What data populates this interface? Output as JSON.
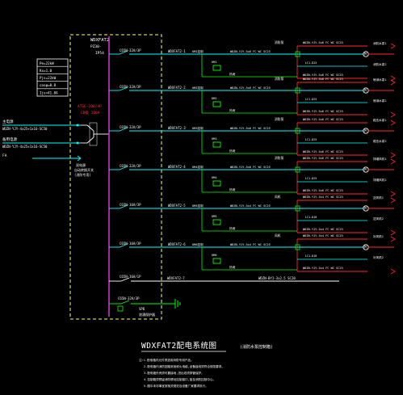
{
  "drawing": {
    "title": "WDXFAT2配电系统图",
    "subtitle": "(消防水泵控制箱)",
    "notes": [
      "注:1.配电箱内元件须选用消防专用产品。",
      "2.配电箱内消防回路采用耐火电缆,设备接线须符合规范要求。",
      "3.配电箱外壳须可靠接地,进出线须穿管保护。",
      "4.控制箱须预留消防联动控制接口,接至消防控制中心。",
      "5.图中未尽事宜按相关规范及设备厂家要求执行。"
    ]
  },
  "panel": {
    "name": "WDXFAT2",
    "sub": "PZ30-",
    "sub2": "IP54",
    "params": [
      "Pe=22kW",
      "Kx=1.0",
      "Pjs=22kW",
      "cosφ=0.8",
      "Ijs=41.8A"
    ],
    "ats": "ATSE-100/4P",
    "ats2": "CB级 100A",
    "ats_note1": "双电源",
    "ats_note2": "自动转换开关",
    "ats_note3": "(消防专用)",
    "feed1_label": "主电源",
    "feed1_cable": "WDZN-YJY-4x25+1x16-SC50",
    "feed2_label": "备用电源",
    "feed2_cable": "WDZN-YJY-4x25+1x16-SC50",
    "feed3_label": "FA",
    "feed3_text": "至消防控制中心"
  },
  "circuits": [
    {
      "breaker": "C65N-32A/3P",
      "id": "WDXFAT2-1",
      "cable": "WDZN-YJY-5x6 FC WC SC25",
      "tag": "KM1",
      "level": "消防泵",
      "sub_cable1": "WDZN-YJY-5x6 FC WC SC25",
      "sub_cable2": "WDZN-YJY-5x6 FC WC SC25",
      "contactor": "LC1-D25",
      "rel": "热继",
      "load1": "消防水泵1",
      "load2": "消防水泵2"
    },
    {
      "breaker": "C65N-32A/3P",
      "id": "WDXFAT2-2",
      "cable": "WDZN-YJY-5x6 FC WC SC25",
      "tag": "KM2",
      "level": "消防泵",
      "sub_cable1": "WDZN-YJY-5x6 FC WC SC25",
      "sub_cable2": "WDZN-YJY-5x6 FC WC SC25",
      "contactor": "LC1-D25",
      "rel": "热继",
      "load1": "喷淋水泵1",
      "load2": "喷淋水泵2"
    },
    {
      "breaker": "C65N-32A/3P",
      "id": "WDXFAT2-3",
      "cable": "WDZN-YJY-5x6 FC WC SC25",
      "tag": "KM3",
      "level": "消防泵",
      "sub_cable1": "WDZN-YJY-5x6 FC WC SC25",
      "sub_cable2": "WDZN-YJY-5x6 FC WC SC25",
      "contactor": "LC1-D25",
      "rel": "热继",
      "load1": "稳压水泵1",
      "load2": "稳压水泵2"
    },
    {
      "breaker": "C65N-32A/3P",
      "id": "WDXFAT2-4",
      "cable": "WDZN-YJY-5x6 FC WC SC25",
      "tag": "KM4",
      "level": "消防泵",
      "sub_cable1": "WDZN-YJY-5x6 FC WC SC25",
      "sub_cable2": "WDZN-YJY-5x6 FC WC SC25",
      "contactor": "LC1-D25",
      "rel": "热继",
      "load1": "排烟风机1",
      "load2": "排烟风机2"
    },
    {
      "breaker": "C65N-16A/3P",
      "id": "WDXFAT2-5",
      "cable": "WDZN-YJY-5x4 FC WC SC25",
      "tag": "KM5",
      "level": "风机",
      "sub_cable1": "WDZN-YJY-5x4 FC WC SC25",
      "sub_cable2": "WDZN-YJY-5x4 FC WC SC25",
      "contactor": "LC1-D18",
      "rel": "热继",
      "load1": "送风机1",
      "load2": "送风机2"
    },
    {
      "breaker": "C65N-16A/3P",
      "id": "WDXFAT2-6",
      "cable": "WDZN-YJY-5x4 FC WC SC25",
      "tag": "KM6",
      "level": "风机",
      "sub_cable1": "WDZN-YJY-5x4 FC WC SC25",
      "sub_cable2": "WDZN-YJY-5x4 FC WC SC25",
      "contactor": "LC1-D18",
      "rel": "热继",
      "load1": "补风机1",
      "load2": "补风机2"
    }
  ],
  "spare": {
    "breaker": "C65N-16A/1P",
    "id": "WDXFAT2-7",
    "cable": "WDZN-BYJ-3x2.5 SC20"
  },
  "surge": {
    "breaker": "C65N-32A/3P",
    "spd": "SPD",
    "label": "浪涌保护器"
  },
  "colors": {
    "bus": "#c832c8",
    "cyan": "#00ffff",
    "red": "#ff2a2a",
    "green": "#00ff00",
    "yellow": "#ffff00",
    "white": "#ffffff",
    "ats": "#ff3030"
  }
}
